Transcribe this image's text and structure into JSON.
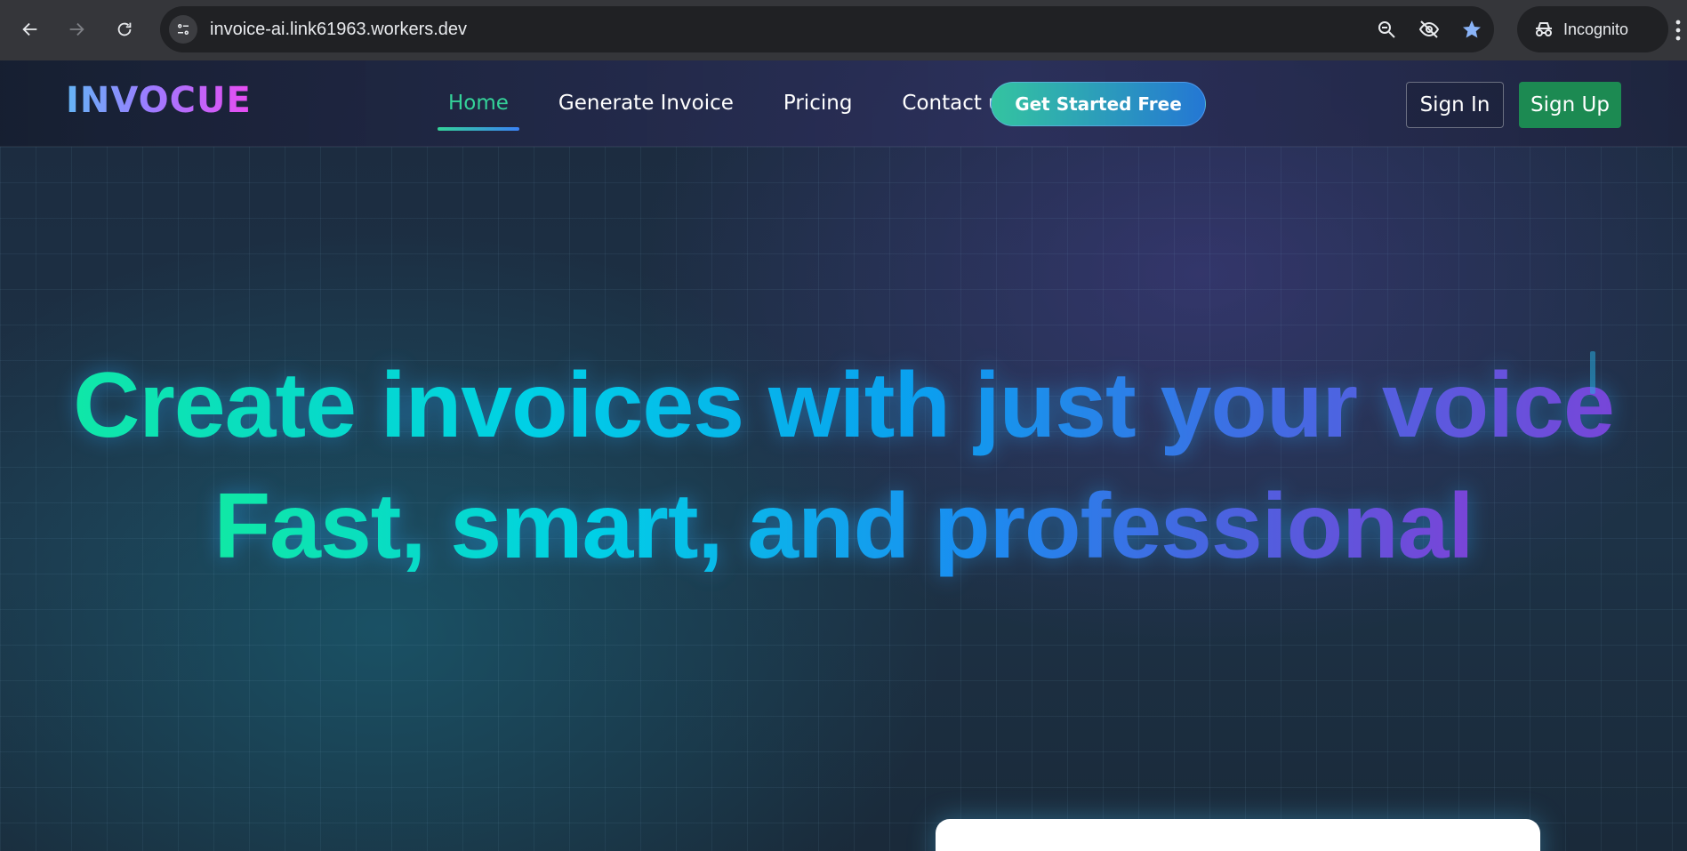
{
  "browser": {
    "url": "invoice-ai.link61963.workers.dev",
    "incognito_label": "Incognito"
  },
  "header": {
    "logo": "INVOCUE",
    "nav": [
      "Home",
      "Generate Invoice",
      "Pricing",
      "Contact us"
    ],
    "cta": "Get Started Free",
    "sign_in": "Sign In",
    "sign_up": "Sign Up"
  },
  "hero": {
    "line1": "Create invoices with just your voice",
    "line2": "Fast, smart, and professional"
  },
  "colors": {
    "accent_green": "#34d399",
    "signup_green": "#1c8a52",
    "logo_gradient_start": "#64b5f6",
    "logo_gradient_end": "#e94cf2"
  }
}
